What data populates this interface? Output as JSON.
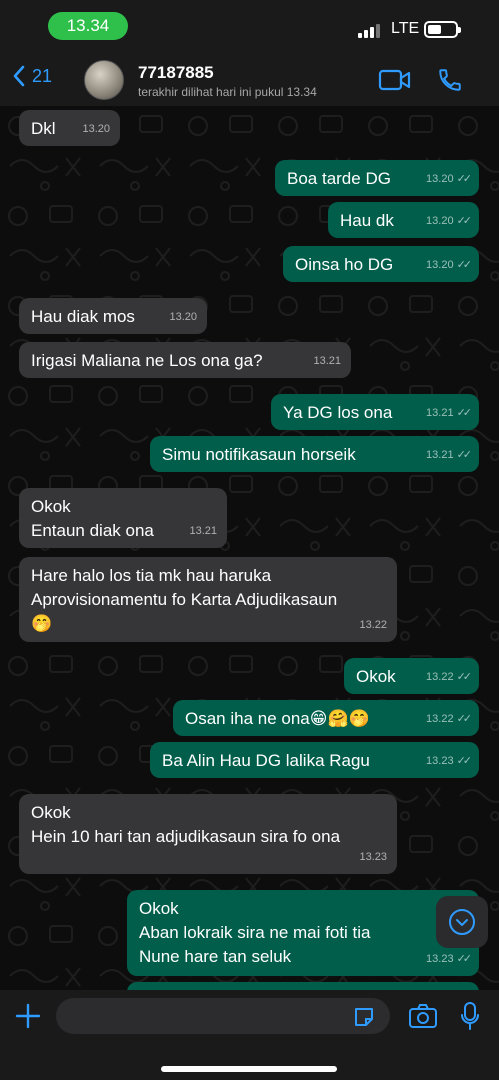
{
  "status_bar": {
    "time": "13.34",
    "network": "LTE"
  },
  "header": {
    "back_count": "21",
    "contact_name": "77187885",
    "last_seen": "terakhir dilihat hari ini pukul 13.34"
  },
  "messages": [
    {
      "dir": "in",
      "text": "Dkl",
      "time": "13.20"
    },
    {
      "dir": "out",
      "text": "Boa tarde DG",
      "time": "13.20"
    },
    {
      "dir": "out",
      "text": "Hau dk",
      "time": "13.20"
    },
    {
      "dir": "out",
      "text": "Oinsa ho DG",
      "time": "13.20"
    },
    {
      "dir": "in",
      "text": "Hau diak mos",
      "time": "13.20"
    },
    {
      "dir": "in",
      "text": "Irigasi Maliana ne Los ona ga?",
      "time": "13.21"
    },
    {
      "dir": "out",
      "text": "Ya DG los ona",
      "time": "13.21"
    },
    {
      "dir": "out",
      "text": "Simu notifikasaun horseik",
      "time": "13.21"
    },
    {
      "dir": "in",
      "text": "Okok\nEntaun diak ona",
      "time": "13.21"
    },
    {
      "dir": "in",
      "text": "Hare halo los tia mk hau haruka\nAprovisionamentu fo Karta Adjudikasaun\n🤭",
      "time": "13.22"
    },
    {
      "dir": "out",
      "text": "Okok",
      "time": "13.22"
    },
    {
      "dir": "out",
      "text": "Osan iha ne ona😁🤗🤭",
      "time": "13.22"
    },
    {
      "dir": "out",
      "text": "Ba Alin Hau DG lalika Ragu",
      "time": "13.23"
    },
    {
      "dir": "in",
      "text": "Okok\nHein 10 hari tan adjudikasaun sira fo ona",
      "time": "13.23"
    },
    {
      "dir": "out",
      "text": "Okok\nAban lokraik sira ne mai foti tia\nNune hare tan seluk",
      "time": "13.23"
    }
  ],
  "input": {
    "placeholder": ""
  },
  "colors": {
    "accent": "#2f9bff",
    "outgoing_bubble": "#005e4b",
    "incoming_bubble": "#363638",
    "time_pill": "#2fc04b"
  },
  "icons": {
    "back": "chevron-left-icon",
    "video": "video-camera-icon",
    "call": "phone-icon",
    "plus": "plus-icon",
    "sticker": "sticker-icon",
    "camera": "camera-icon",
    "mic": "microphone-icon",
    "scroll": "chevron-down-circle-icon",
    "read": "double-check-icon"
  }
}
